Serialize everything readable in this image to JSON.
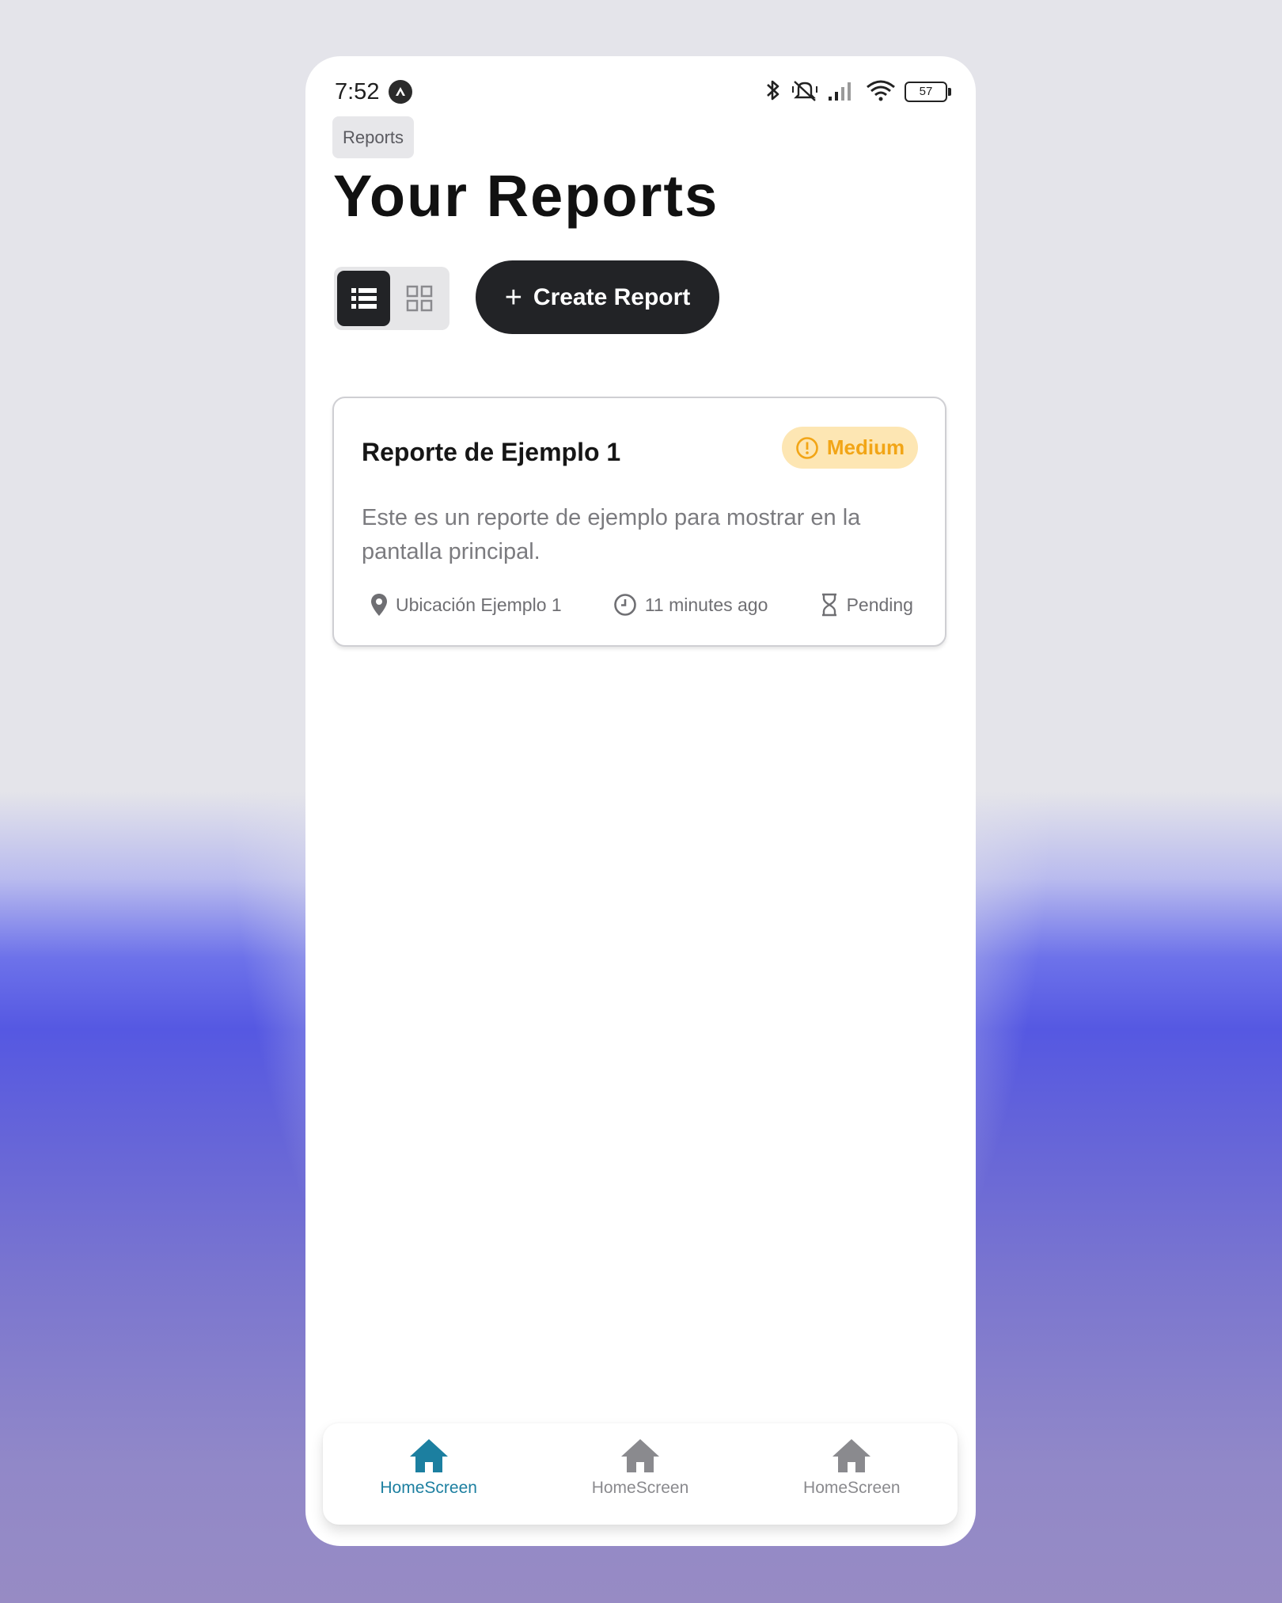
{
  "status_bar": {
    "time": "7:52",
    "battery": "57",
    "icons": [
      "bluetooth-icon",
      "vibrate-silent-icon",
      "signal-icon",
      "wifi-icon",
      "battery-icon"
    ]
  },
  "breadcrumb": "Reports",
  "page_title": "Your Reports",
  "view_toggle": {
    "options": [
      "list-view",
      "grid-view"
    ],
    "selected": "list-view"
  },
  "create_button_label": "Create Report",
  "reports": [
    {
      "title": "Reporte de Ejemplo 1",
      "severity": "Medium",
      "description": "Este es un reporte de ejemplo para mostrar en la pantalla principal.",
      "location": "Ubicación Ejemplo 1",
      "time_ago": "11 minutes ago",
      "status": "Pending"
    }
  ],
  "tabs": [
    {
      "label": "HomeScreen",
      "icon": "home-icon",
      "active": true
    },
    {
      "label": "HomeScreen",
      "icon": "home-icon",
      "active": false
    },
    {
      "label": "HomeScreen",
      "icon": "home-icon",
      "active": false
    }
  ],
  "colors": {
    "primary_dark": "#222326",
    "severity_medium_bg": "#fde6b3",
    "severity_medium_text": "#f2a516",
    "tab_active": "#1c7fa0",
    "tab_inactive": "#8a8a8e"
  }
}
